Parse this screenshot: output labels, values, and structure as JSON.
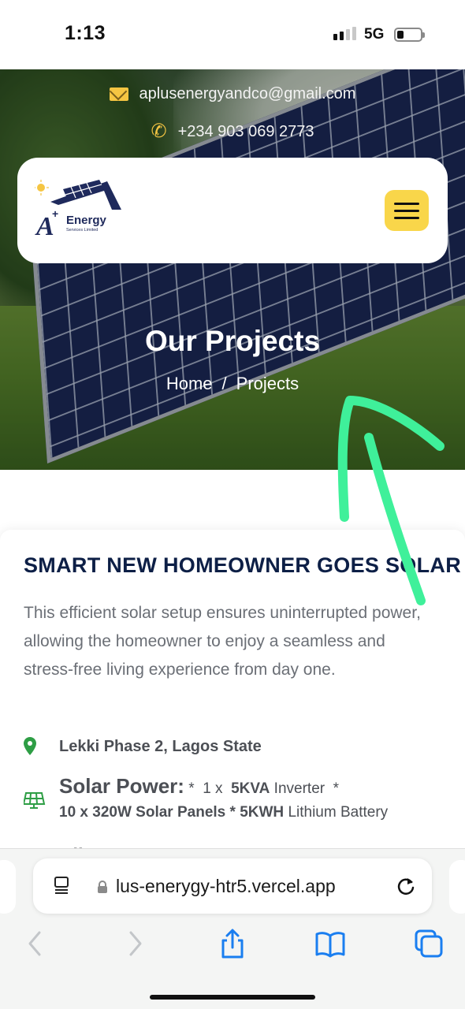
{
  "status_bar": {
    "time": "1:13",
    "network": "5G",
    "signal_bars_active": 2,
    "battery_fraction": 0.2
  },
  "header": {
    "email": "aplusenergyandco@gmail.com",
    "phone": "+234 903 069 2773",
    "logo": {
      "brand": "Energy",
      "subtitle": "Services Limited"
    },
    "menu_icon": "hamburger-icon"
  },
  "hero": {
    "title": "Our Projects",
    "breadcrumb": {
      "home": "Home",
      "separator": "/",
      "current": "Projects"
    }
  },
  "project": {
    "title": "SMART NEW HOMEOWNER GOES SOLAR",
    "description": "This efficient solar setup ensures uninterrupted power, allowing the homeowner to enjoy a seamless and stress-free living experience from day one.",
    "location": "Lekki Phase 2, Lagos State",
    "solar_power": {
      "label": "Solar Power:",
      "line1": {
        "star_a": "*",
        "count": "1 x",
        "kva": "5KVA",
        "inverter": "Inverter",
        "star_b": "*"
      },
      "line2": {
        "panels": "10 x 320W Solar Panels",
        "star": "*",
        "kwh": "5KWH",
        "battery": "Lithium Battery"
      }
    },
    "cut_off_text": "Client"
  },
  "browser": {
    "url": "lus-enerygy-htr5.vercel.app",
    "toolbar_icons": [
      "back-icon",
      "forward-icon",
      "share-icon",
      "bookmarks-icon",
      "tabs-icon"
    ]
  },
  "colors": {
    "accent_yellow": "#f9d64a",
    "title_navy": "#0d1f46",
    "location_green": "#2e9e45",
    "ios_blue": "#1a7ef0",
    "annotation_green": "#3ff09a"
  }
}
